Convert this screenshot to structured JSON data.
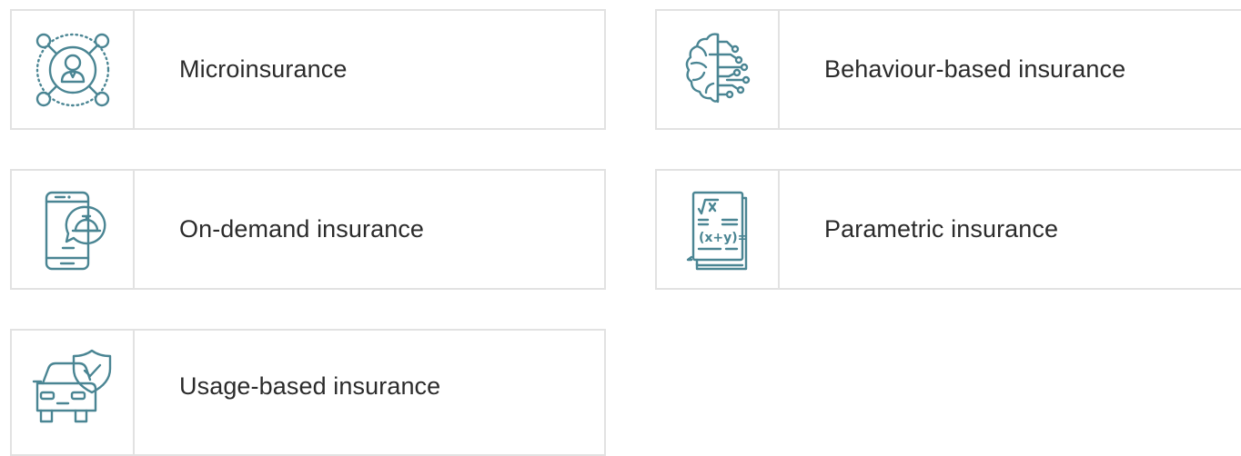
{
  "cards": [
    {
      "label": "Microinsurance",
      "icon": "user-network-icon"
    },
    {
      "label": "Behaviour-based insurance",
      "icon": "brain-circuit-icon"
    },
    {
      "label": "On-demand insurance",
      "icon": "phone-service-bell-icon"
    },
    {
      "label": "Parametric insurance",
      "icon": "math-formula-book-icon"
    },
    {
      "label": "Usage-based insurance",
      "icon": "car-shield-icon"
    }
  ],
  "colors": {
    "icon": "#4a8593",
    "border": "#e2e2e2",
    "text": "#2b2b2b"
  }
}
